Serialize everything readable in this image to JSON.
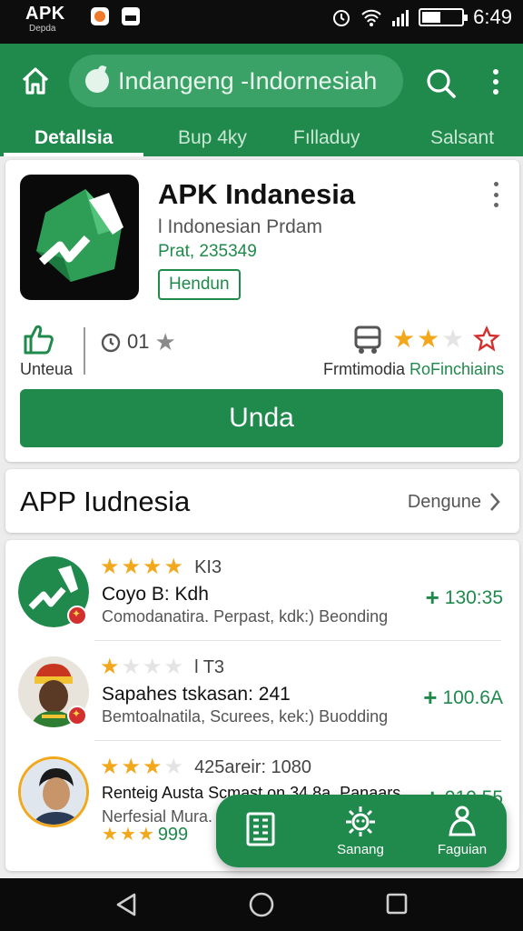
{
  "status_bar": {
    "brand": "APK",
    "brand_sub": "Depda",
    "time": "6:49"
  },
  "app_bar": {
    "search_text": "Indangeng -Indornesiah"
  },
  "tabs": [
    {
      "label": "Detallsia",
      "active": true
    },
    {
      "label": "Bup 4ky",
      "active": false
    },
    {
      "label": "Fılladuy",
      "active": false
    },
    {
      "label": "Salsant",
      "active": false
    }
  ],
  "app_card": {
    "name": "APK Indanesia",
    "subtitle": "l Indonesian Prdam",
    "price": "Prat, 235349",
    "tag": "Hendun",
    "install_label": "Unteua",
    "rating_count": "01",
    "stars_filled": 2,
    "stars_total": 3,
    "publisher_a": "Frmtimodia",
    "publisher_b": "RoFinchiains",
    "install_button": "Unda"
  },
  "section": {
    "title": "APP Iudnesia",
    "link": "Dengune"
  },
  "list": [
    {
      "rating_text": "KI3",
      "stars_filled": 4,
      "stars_total": 4,
      "title": "Coyo B: Kdh",
      "desc": "Comodanatira. Perpast, kdk:) Beonding",
      "size": "130:35"
    },
    {
      "rating_text": "l T3",
      "stars_filled": 1,
      "stars_total": 4,
      "title": "Sapahes tskasan: 241",
      "desc": "Bemtoalnatila, Scurees, kek:) Buodding",
      "size": "100.6A"
    },
    {
      "rating_text": "425areir: 1080",
      "stars_filled": 3,
      "stars_total": 4,
      "title": "Renteig Austa Scmast on 34 8a. Panaars",
      "desc": "Nerfesial Mura.",
      "size": "010.55",
      "small_rating": "999",
      "small_stars_filled": 3
    }
  ],
  "fab_bar": {
    "item1_label": "",
    "item2_label": "Sanang",
    "item3_label": "Faguian"
  },
  "colors": {
    "primary": "#1f8a4c",
    "star": "#f2a81c",
    "badge": "#d32f2f"
  },
  "icons": [
    "home-icon",
    "leaf-icon",
    "search-icon",
    "more-vert-icon",
    "app-logo-icon",
    "thumbs-up-icon",
    "clock-icon",
    "bus-icon",
    "star-outline-icon",
    "chevron-right-icon",
    "building-icon",
    "sun-gear-icon",
    "person-icon",
    "back-icon",
    "home-circle-icon",
    "recents-icon"
  ]
}
